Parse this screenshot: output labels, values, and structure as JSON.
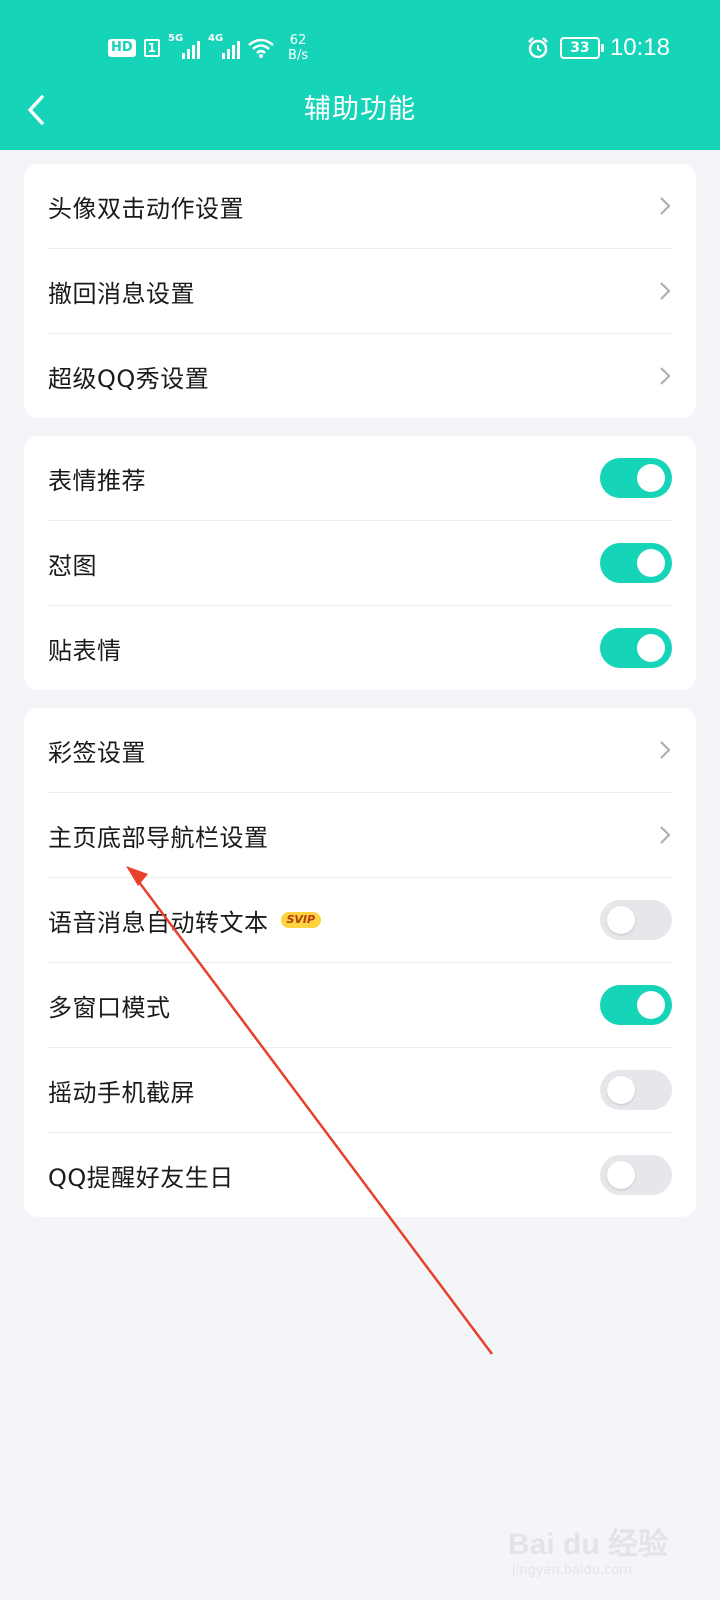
{
  "status_bar": {
    "hd": "HD",
    "sim": "1",
    "net1": "5G",
    "net2": "4G",
    "speed_value": "62",
    "speed_unit": "B/s",
    "battery": "33",
    "time": "10:18"
  },
  "header": {
    "title": "辅助功能"
  },
  "groups": [
    {
      "items": [
        {
          "label": "头像双击动作设置",
          "type": "link"
        },
        {
          "label": "撤回消息设置",
          "type": "link"
        },
        {
          "label": "超级QQ秀设置",
          "type": "link"
        }
      ]
    },
    {
      "items": [
        {
          "label": "表情推荐",
          "type": "toggle",
          "on": true
        },
        {
          "label": "怼图",
          "type": "toggle",
          "on": true
        },
        {
          "label": "贴表情",
          "type": "toggle",
          "on": true
        }
      ]
    },
    {
      "items": [
        {
          "label": "彩签设置",
          "type": "link"
        },
        {
          "label": "主页底部导航栏设置",
          "type": "link"
        },
        {
          "label": "语音消息自动转文本",
          "type": "toggle",
          "on": false,
          "badge": "SVIP"
        },
        {
          "label": "多窗口模式",
          "type": "toggle",
          "on": true
        },
        {
          "label": "摇动手机截屏",
          "type": "toggle",
          "on": false
        },
        {
          "label": "QQ提醒好友生日",
          "type": "toggle",
          "on": false
        }
      ]
    }
  ],
  "watermark": {
    "brand": "Bai du 经验",
    "url": "jingyan.baidu.com"
  },
  "colors": {
    "accent": "#15d4b7",
    "annotation_arrow": "#e8402c"
  }
}
